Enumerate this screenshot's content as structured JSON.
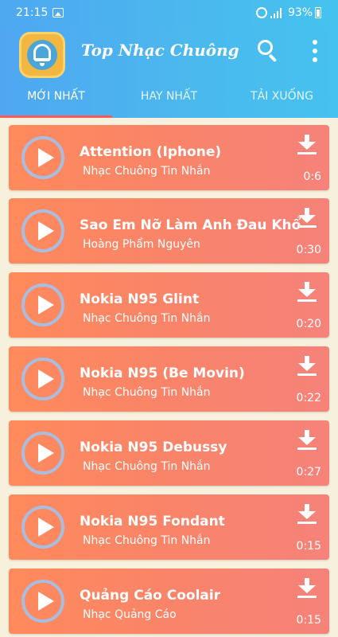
{
  "status_bar": {
    "time": "21:15",
    "battery": "93%"
  },
  "app": {
    "title": "Top Nhạc Chuông",
    "accent_color": "#4bb5ef",
    "card_color": "#f98469"
  },
  "tabs": [
    {
      "label": "MỚI NHẤT",
      "selected": true
    },
    {
      "label": "HAY NHẤT",
      "selected": false
    },
    {
      "label": "TẢI XUỐNG",
      "selected": false
    }
  ],
  "songs": [
    {
      "title": "Attention (Iphone)",
      "subtitle": "Nhạc Chuông Tin Nhắn",
      "duration": "0:6"
    },
    {
      "title": "Sao Em Nỡ Làm Anh Đau Khổ",
      "subtitle": "Hoàng Phẩm Nguyên",
      "duration": "0:30"
    },
    {
      "title": "Nokia N95 Glint",
      "subtitle": "Nhạc Chuông Tin Nhắn",
      "duration": "0:20"
    },
    {
      "title": "Nokia N95 (Be Movin)",
      "subtitle": "Nhạc Chuông Tin Nhắn",
      "duration": "0:22"
    },
    {
      "title": "Nokia N95 Debussy",
      "subtitle": "Nhạc Chuông Tin Nhắn",
      "duration": "0:27"
    },
    {
      "title": "Nokia N95 Fondant",
      "subtitle": "Nhạc Chuông Tin Nhắn",
      "duration": "0:15"
    },
    {
      "title": "Quảng Cáo Coolair",
      "subtitle": "Nhạc Quảng Cáo",
      "duration": "0:15"
    }
  ],
  "icons": {
    "play": "play-icon",
    "download": "download-icon",
    "search": "search-icon",
    "more": "more-vert-icon"
  }
}
